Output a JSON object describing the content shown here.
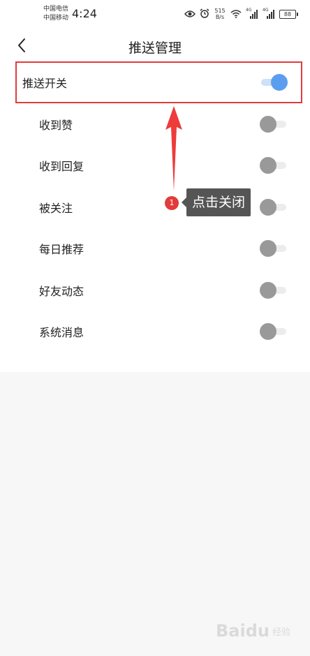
{
  "status_bar": {
    "carrier_1": "中国电信",
    "carrier_2": "中国移动",
    "time": "4:24",
    "net_speed_value": "515",
    "net_speed_unit": "B/s",
    "signal_1_label": "4G",
    "signal_2_label": "4G",
    "battery": "88",
    "icons": [
      "eye-icon",
      "alarm-icon",
      "wifi-icon",
      "signal-icon",
      "signal-icon",
      "battery-icon"
    ]
  },
  "header": {
    "title": "推送管理",
    "back_icon": "chevron-left-icon"
  },
  "settings": {
    "master": {
      "label": "推送开关",
      "enabled": true
    },
    "items": [
      {
        "label": "收到赞",
        "enabled": false
      },
      {
        "label": "收到回复",
        "enabled": false
      },
      {
        "label": "被关注",
        "enabled": false
      },
      {
        "label": "每日推荐",
        "enabled": false
      },
      {
        "label": "好友动态",
        "enabled": false
      },
      {
        "label": "系统消息",
        "enabled": false
      }
    ]
  },
  "annotation": {
    "step": "1",
    "text": "点击关闭",
    "arrow_icon": "arrow-up-icon"
  },
  "watermark": {
    "brand": "Baidu",
    "sub": "经验"
  },
  "colors": {
    "toggle_on": "#5b9ef0",
    "toggle_off": "#999999",
    "highlight": "#e23b3b",
    "callout_bg": "#555555"
  }
}
